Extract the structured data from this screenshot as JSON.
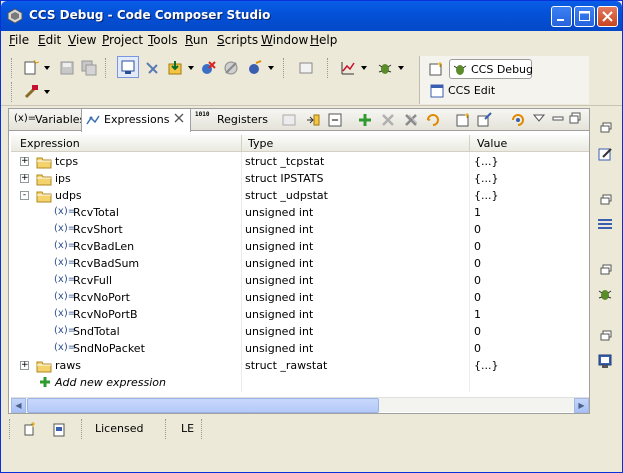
{
  "window": {
    "title": "CCS Debug - Code Composer Studio",
    "accent": "#0452d8"
  },
  "menu": {
    "items": [
      {
        "label": "File",
        "accel": "F",
        "rest": "ile"
      },
      {
        "label": "Edit",
        "accel": "E",
        "rest": "dit"
      },
      {
        "label": "View",
        "accel": "V",
        "rest": "iew"
      },
      {
        "label": "Project",
        "accel": "P",
        "rest": "roject"
      },
      {
        "label": "Tools",
        "accel": "T",
        "rest": "ools"
      },
      {
        "label": "Run",
        "accel": "R",
        "rest": "un"
      },
      {
        "label": "Scripts",
        "accel": "S",
        "rest": "cripts"
      },
      {
        "label": "Window",
        "accel": "W",
        "rest": "indow"
      },
      {
        "label": "Help",
        "accel": "H",
        "rest": "elp"
      }
    ]
  },
  "perspectives": {
    "debug_label": "CCS Debug",
    "edit_label": "CCS Edit"
  },
  "tabs": {
    "variables": "Variables",
    "expressions": "Expressions",
    "registers": "Registers",
    "registers_icon_text": "1010"
  },
  "table": {
    "headers": {
      "expression": "Expression",
      "type": "Type",
      "value": "Value"
    },
    "rows": [
      {
        "name": "tcps",
        "type": "struct _tcpstat",
        "value": "{...}",
        "kind": "struct",
        "expander": "+"
      },
      {
        "name": "ips",
        "type": "struct IPSTATS",
        "value": "{...}",
        "kind": "struct",
        "expander": "+"
      },
      {
        "name": "udps",
        "type": "struct _udpstat",
        "value": "{...}",
        "kind": "struct",
        "expander": "-"
      },
      {
        "name": "RcvTotal",
        "type": "unsigned int",
        "value": "1",
        "kind": "field"
      },
      {
        "name": "RcvShort",
        "type": "unsigned int",
        "value": "0",
        "kind": "field"
      },
      {
        "name": "RcvBadLen",
        "type": "unsigned int",
        "value": "0",
        "kind": "field"
      },
      {
        "name": "RcvBadSum",
        "type": "unsigned int",
        "value": "0",
        "kind": "field"
      },
      {
        "name": "RcvFull",
        "type": "unsigned int",
        "value": "0",
        "kind": "field"
      },
      {
        "name": "RcvNoPort",
        "type": "unsigned int",
        "value": "0",
        "kind": "field"
      },
      {
        "name": "RcvNoPortB",
        "type": "unsigned int",
        "value": "1",
        "kind": "field"
      },
      {
        "name": "SndTotal",
        "type": "unsigned int",
        "value": "0",
        "kind": "field"
      },
      {
        "name": "SndNoPacket",
        "type": "unsigned int",
        "value": "0",
        "kind": "field"
      },
      {
        "name": "raws",
        "type": "struct _rawstat",
        "value": "{...}",
        "kind": "struct",
        "expander": "+"
      }
    ],
    "add_new": "Add new expression",
    "field_prefix": "(x)="
  },
  "status": {
    "licensed": "Licensed",
    "endian": "LE"
  }
}
